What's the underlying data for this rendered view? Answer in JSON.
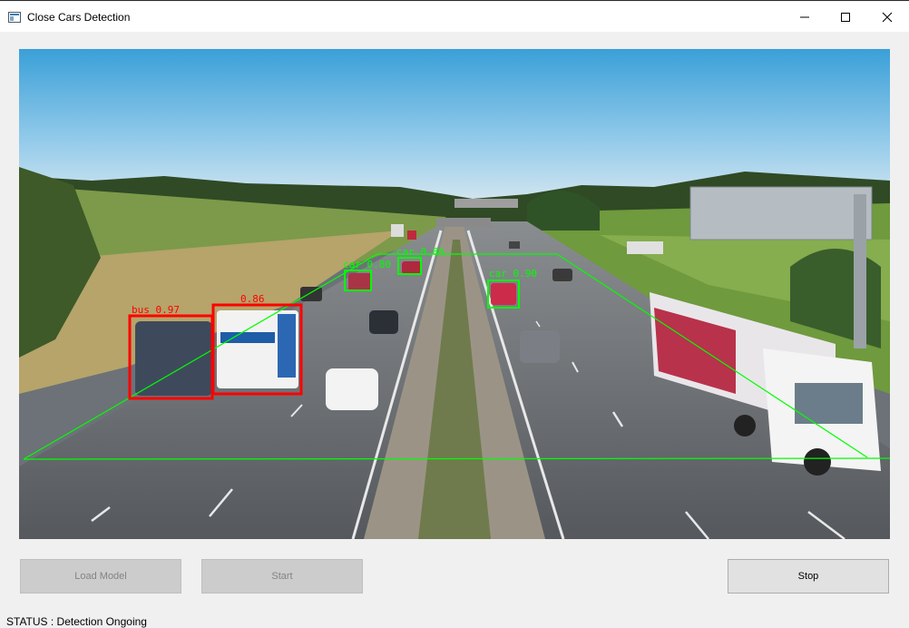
{
  "window": {
    "title": "Close Cars Detection"
  },
  "video": {
    "detections": [
      {
        "label": "bus 0.97",
        "color": "#ff0000"
      },
      {
        "label": "0.86",
        "color": "#ff0000"
      },
      {
        "label": "car 0.80",
        "color": "#00ff00"
      },
      {
        "label": "car 0.86",
        "color": "#00ff00"
      },
      {
        "label": "car 0.90",
        "color": "#00ff00"
      }
    ]
  },
  "buttons": {
    "load_model": "Load Model",
    "start": "Start",
    "stop": "Stop"
  },
  "status": {
    "text": "STATUS : Detection Ongoing"
  },
  "colors": {
    "close_box": "#ff0000",
    "far_box": "#00ff00",
    "zone_line": "#00ff00"
  }
}
